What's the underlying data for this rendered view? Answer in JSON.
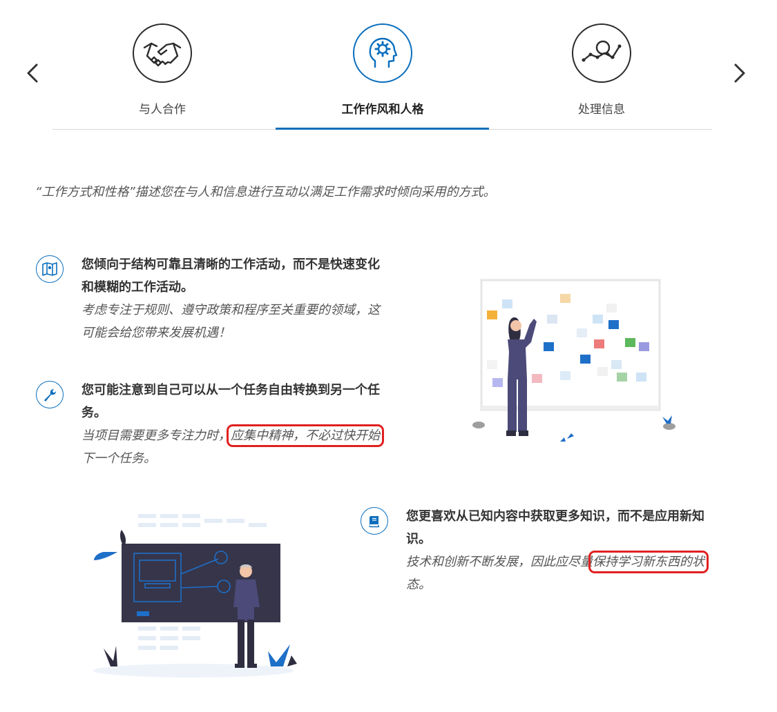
{
  "nav": {
    "prev_icon": "chevron-left-icon",
    "next_icon": "chevron-right-icon"
  },
  "tabs": [
    {
      "label": "与人合作",
      "icon": "handshake-icon"
    },
    {
      "label": "工作作风和人格",
      "icon": "head-gear-icon",
      "active": true
    },
    {
      "label": "处理信息",
      "icon": "magnifier-chart-icon"
    }
  ],
  "intro": "“工作方式和性格”描述您在与人和信息进行互动以满足工作需求时倾向采用的方式。",
  "traits": [
    {
      "icon": "map-icon",
      "heading_line1": "您倾向于结构可靠且清晰的工作活动，而不是快速变化",
      "heading_line2": "和模糊的工作活动。",
      "desc_line1": "考虑专注于规则、遵守政策和程序至关重要的领域，这",
      "desc_line2": "可能会给您带来发展机遇！"
    },
    {
      "icon": "wrench-icon",
      "heading_line1": "您可能注意到自己可以从一个任务自由转换到另一个任",
      "heading_line2": "务。",
      "desc_pre": "当项目需要更多专注力时，",
      "desc_highlight": "应集中精神，不必过快开始",
      "desc_line2": "下一个任务。"
    },
    {
      "icon": "book-icon",
      "heading_line1": "您更喜欢从已知内容中获取更多知识，而不是应用新知",
      "heading_line2": "识。",
      "desc_pre": "技术和创新不断发展，因此应尽量",
      "desc_highlight": "保持学习新东西的状",
      "desc_line2": "态。"
    }
  ],
  "colors": {
    "accent": "#0a6ebd",
    "highlight_box": "#e02020"
  }
}
